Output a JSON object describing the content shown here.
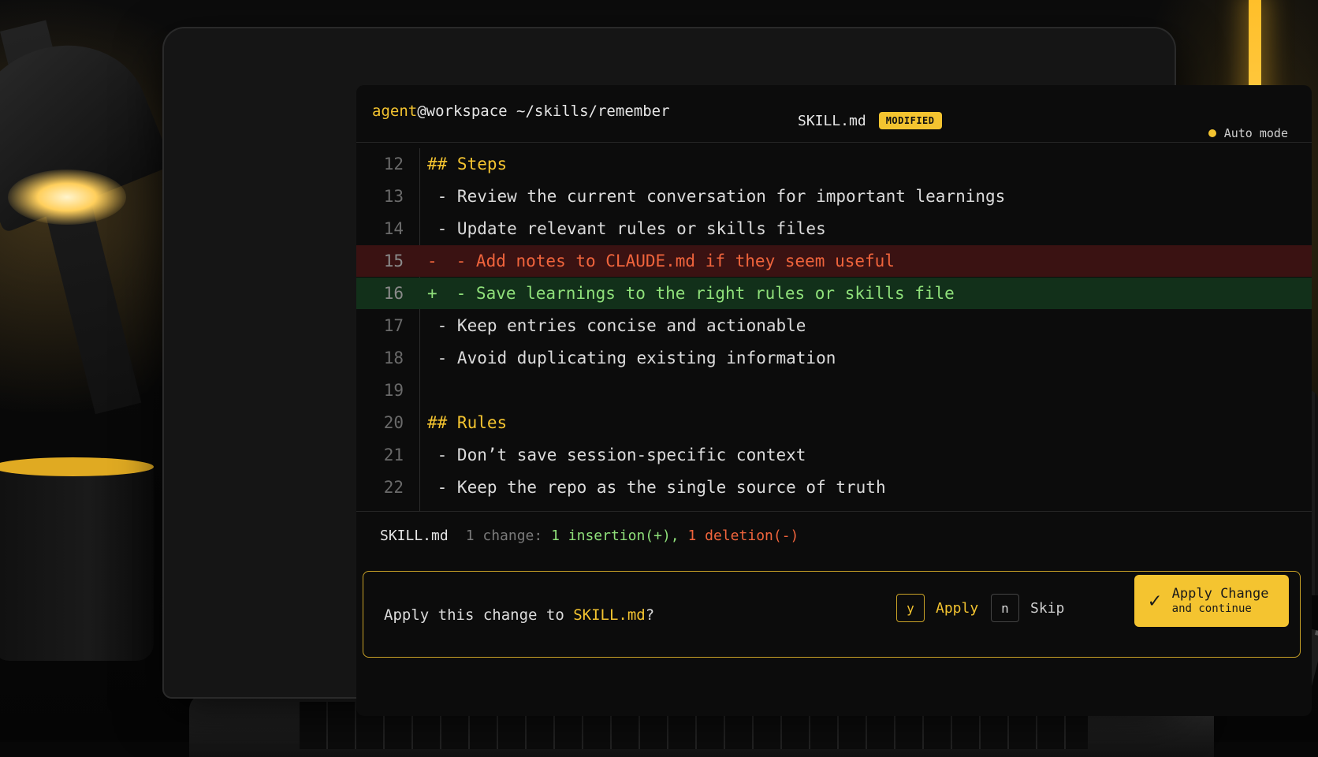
{
  "titlebar": {
    "user": "agent",
    "host": "@workspace",
    "path": "~/skills/remember",
    "filename": "SKILL.md",
    "badge": "MODIFIED",
    "mode": "Auto mode"
  },
  "code": {
    "lines": [
      {
        "num": "12",
        "text": "## Steps",
        "kind": "heading"
      },
      {
        "num": "13",
        "text": " - Review the current conversation for important learnings",
        "kind": "normal"
      },
      {
        "num": "14",
        "text": " - Update relevant rules or skills files",
        "kind": "normal"
      },
      {
        "num": "15",
        "sign": "-",
        "text": " - Add notes to CLAUDE.md if they seem useful",
        "kind": "deleted"
      },
      {
        "num": "16",
        "sign": "+",
        "text": " - Save learnings to the right rules or skills file",
        "kind": "added"
      },
      {
        "num": "17",
        "text": " - Keep entries concise and actionable",
        "kind": "normal"
      },
      {
        "num": "18",
        "text": " - Avoid duplicating existing information",
        "kind": "normal"
      },
      {
        "num": "19",
        "text": "",
        "kind": "normal"
      },
      {
        "num": "20",
        "text": "## Rules",
        "kind": "heading"
      },
      {
        "num": "21",
        "text": " - Don’t save session-specific context",
        "kind": "normal"
      },
      {
        "num": "22",
        "text": " - Keep the repo as the single source of truth",
        "kind": "normal"
      }
    ]
  },
  "statusbar": {
    "filename": "SKILL.md",
    "change_count": "1 change:",
    "insertions": "1 insertion(+),",
    "deletions": "1 deletion(-)"
  },
  "applybar": {
    "question_prefix": "Apply this change to ",
    "question_file": "SKILL.md",
    "question_suffix": "?",
    "yes_key": "y",
    "yes_label": "Apply",
    "no_key": "n",
    "no_label": "Skip",
    "button_main": "Apply Change",
    "button_sub": "and continue",
    "button_icon": "check-icon"
  },
  "colors": {
    "accent": "#f4c430",
    "added": "#8fe07a",
    "deleted": "#f0643c",
    "added_bg": "#12301a",
    "deleted_bg": "#3a1212"
  }
}
